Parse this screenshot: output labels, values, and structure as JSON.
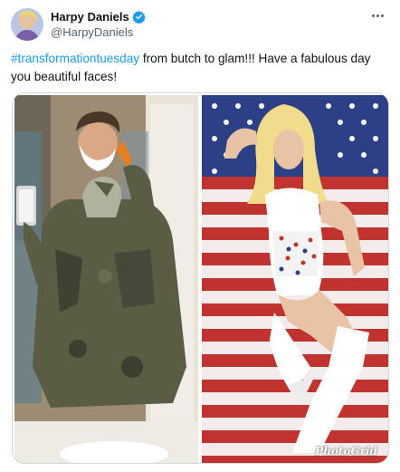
{
  "author": {
    "display_name": "Harpy Daniels",
    "handle": "@HarpyDaniels",
    "verified": true
  },
  "tweet": {
    "hashtag": "#transformationtuesday",
    "body": " from butch to glam!!!  Have a fabulous day you beautiful faces!"
  },
  "media": {
    "left_photo": "man-in-navy-uniform-shaving-selfie",
    "right_photo": "glam-outfit-on-american-flag",
    "watermark": "PhotoGrid"
  },
  "icons": {
    "verified": "verified-badge-icon",
    "more": "more-options-icon"
  },
  "colors": {
    "accent": "#1d9bf0",
    "text": "#0f1419",
    "secondary": "#536471",
    "border": "#cfd9de"
  }
}
